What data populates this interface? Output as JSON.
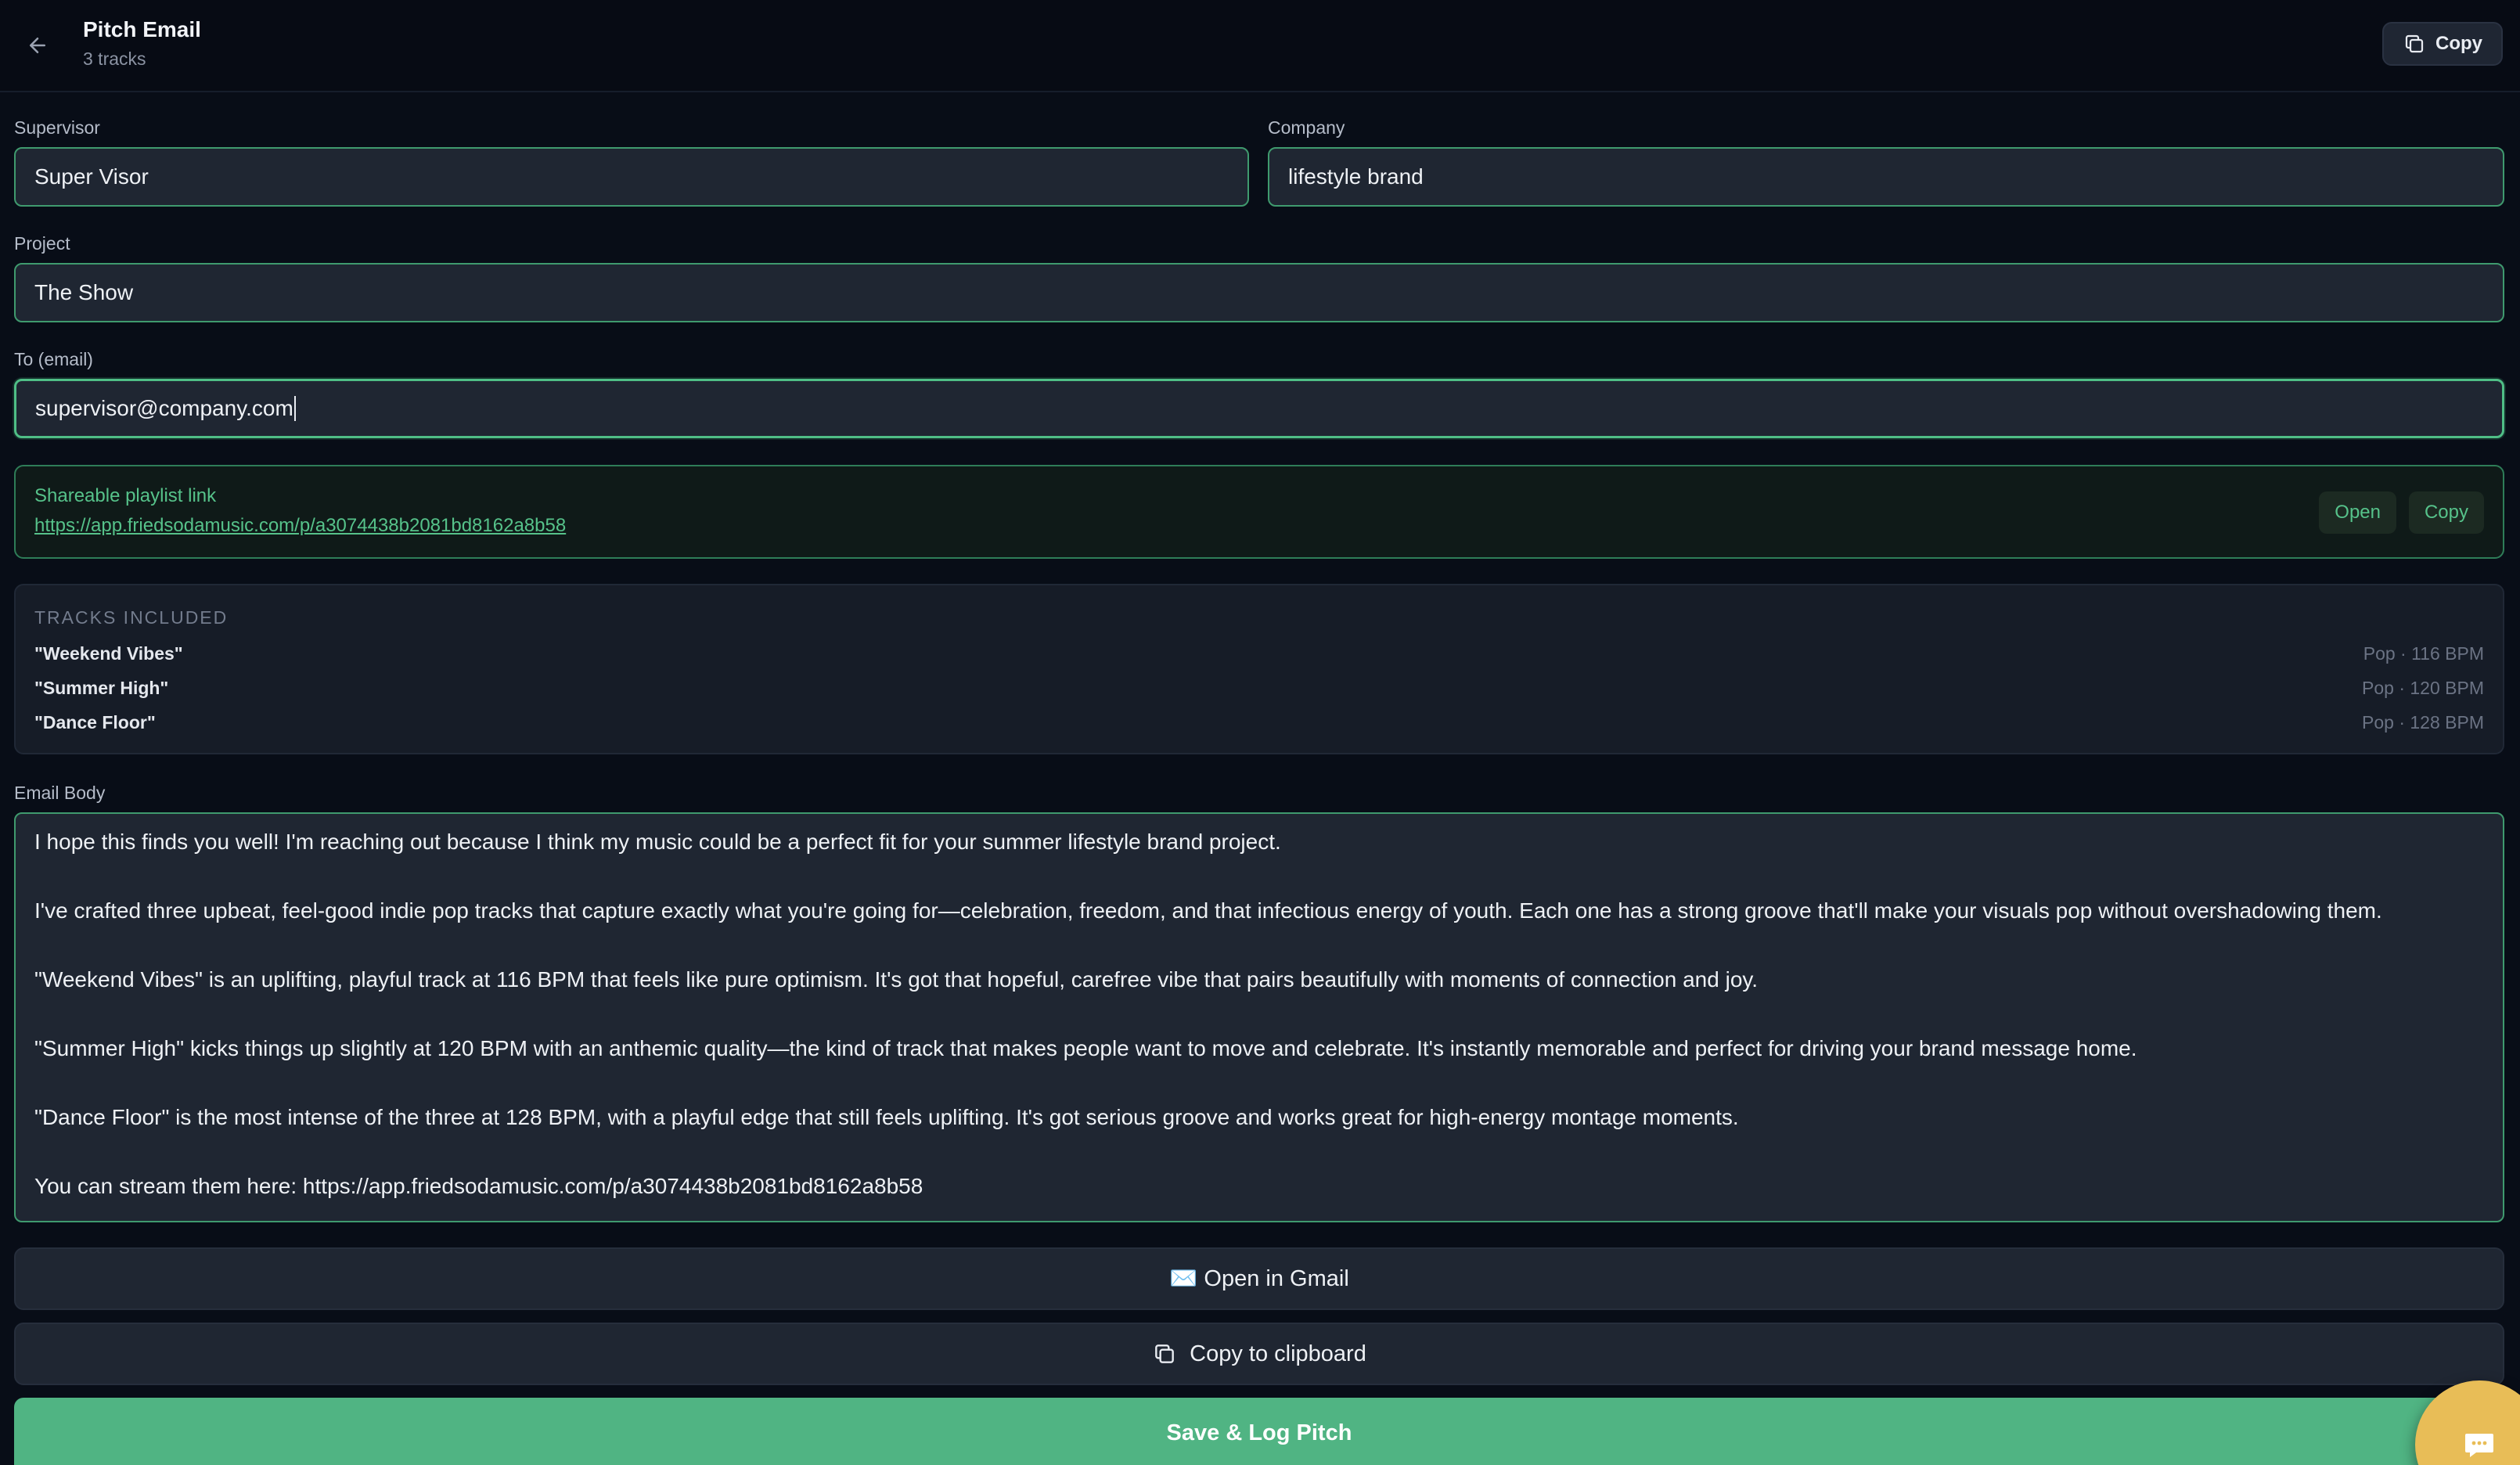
{
  "header": {
    "title": "Pitch Email",
    "subtitle": "3 tracks",
    "copy_label": "Copy"
  },
  "form": {
    "supervisor": {
      "label": "Supervisor",
      "value": "Super Visor"
    },
    "company": {
      "label": "Company",
      "value": "lifestyle brand"
    },
    "project": {
      "label": "Project",
      "value": "The Show"
    },
    "to_email": {
      "label": "To (email)",
      "value": "supervisor@company.com"
    }
  },
  "playlist": {
    "label": "Shareable playlist link",
    "url": "https://app.friedsodamusic.com/p/a3074438b2081bd8162a8b58",
    "open_label": "Open",
    "copy_label": "Copy"
  },
  "tracks": {
    "title": "TRACKS INCLUDED",
    "items": [
      {
        "name": "\"Weekend Vibes\"",
        "meta": "Pop · 116 BPM"
      },
      {
        "name": "\"Summer High\"",
        "meta": "Pop · 120 BPM"
      },
      {
        "name": "\"Dance Floor\"",
        "meta": "Pop · 128 BPM"
      }
    ]
  },
  "email_body": {
    "label": "Email Body",
    "paragraphs": [
      "I hope this finds you well! I'm reaching out because I think my music could be a perfect fit for your summer lifestyle brand project.",
      "I've crafted three upbeat, feel-good indie pop tracks that capture exactly what you're going for—celebration, freedom, and that infectious energy of youth. Each one has a strong groove that'll make your visuals pop without overshadowing them.",
      "\"Weekend Vibes\" is an uplifting, playful track at 116 BPM that feels like pure optimism. It's got that hopeful, carefree vibe that pairs beautifully with moments of connection and joy.",
      "\"Summer High\" kicks things up slightly at 120 BPM with an anthemic quality—the kind of track that makes people want to move and celebrate. It's instantly memorable and perfect for driving your brand message home.",
      "\"Dance Floor\" is the most intense of the three at 128 BPM, with a playful edge that still feels uplifting. It's got serious groove and works great for high-energy montage moments.",
      "You can stream them here: https://app.friedsodamusic.com/p/a3074438b2081bd8162a8b58"
    ]
  },
  "actions": {
    "gmail_label": "✉️ Open in Gmail",
    "clipboard_label": "Copy to clipboard",
    "save_label": "Save & Log Pitch"
  },
  "colors": {
    "accent": "#50b483",
    "link": "#56c28a",
    "chat_fab": "#e8bd57"
  }
}
